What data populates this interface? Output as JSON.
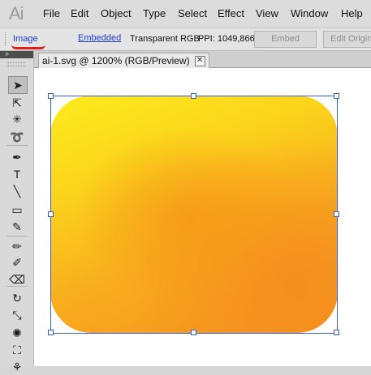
{
  "app": {
    "logo": "Ai"
  },
  "menu": [
    "File",
    "Edit",
    "Object",
    "Type",
    "Select",
    "Effect",
    "View",
    "Window",
    "Help"
  ],
  "controlbar": {
    "image_label": "Image",
    "embedded_label": "Embedded",
    "color_mode": "Transparent RGB",
    "ppi": "PPI: 1049,866",
    "embed_button": "Embed",
    "edit_original_button": "Edit Original"
  },
  "document": {
    "tab_title": "ai-1.svg @ 1200% (RGB/Preview)",
    "close_glyph": "✕"
  },
  "tools": {
    "header_arrows": "»",
    "items": [
      {
        "name": "selection-tool-icon",
        "glyph": "➤"
      },
      {
        "name": "direct-selection-tool-icon",
        "glyph": "⇱"
      },
      {
        "name": "magic-wand-tool-icon",
        "glyph": "✳"
      },
      {
        "name": "lasso-tool-icon",
        "glyph": "➰"
      },
      {
        "name": "pen-tool-icon",
        "glyph": "✒"
      },
      {
        "name": "type-tool-icon",
        "glyph": "T"
      },
      {
        "name": "line-segment-tool-icon",
        "glyph": "╲"
      },
      {
        "name": "rectangle-tool-icon",
        "glyph": "▭"
      },
      {
        "name": "paintbrush-tool-icon",
        "glyph": "✎"
      },
      {
        "name": "pencil-tool-icon",
        "glyph": "✏"
      },
      {
        "name": "blob-brush-tool-icon",
        "glyph": "✐"
      },
      {
        "name": "eraser-tool-icon",
        "glyph": "⌫"
      },
      {
        "name": "rotate-tool-icon",
        "glyph": "↻"
      },
      {
        "name": "scale-tool-icon",
        "glyph": "⤡"
      },
      {
        "name": "warp-tool-icon",
        "glyph": "✺"
      },
      {
        "name": "free-transform-tool-icon",
        "glyph": "⛶"
      },
      {
        "name": "symbol-sprayer-tool-icon",
        "glyph": "⚘"
      }
    ]
  },
  "colors": {
    "link_blue": "#1f3cd0",
    "underline_red": "#e31b1b",
    "selection_blue": "#3a5bd1",
    "art_yellow": "#fcec1c",
    "art_orange": "#f5921f"
  }
}
